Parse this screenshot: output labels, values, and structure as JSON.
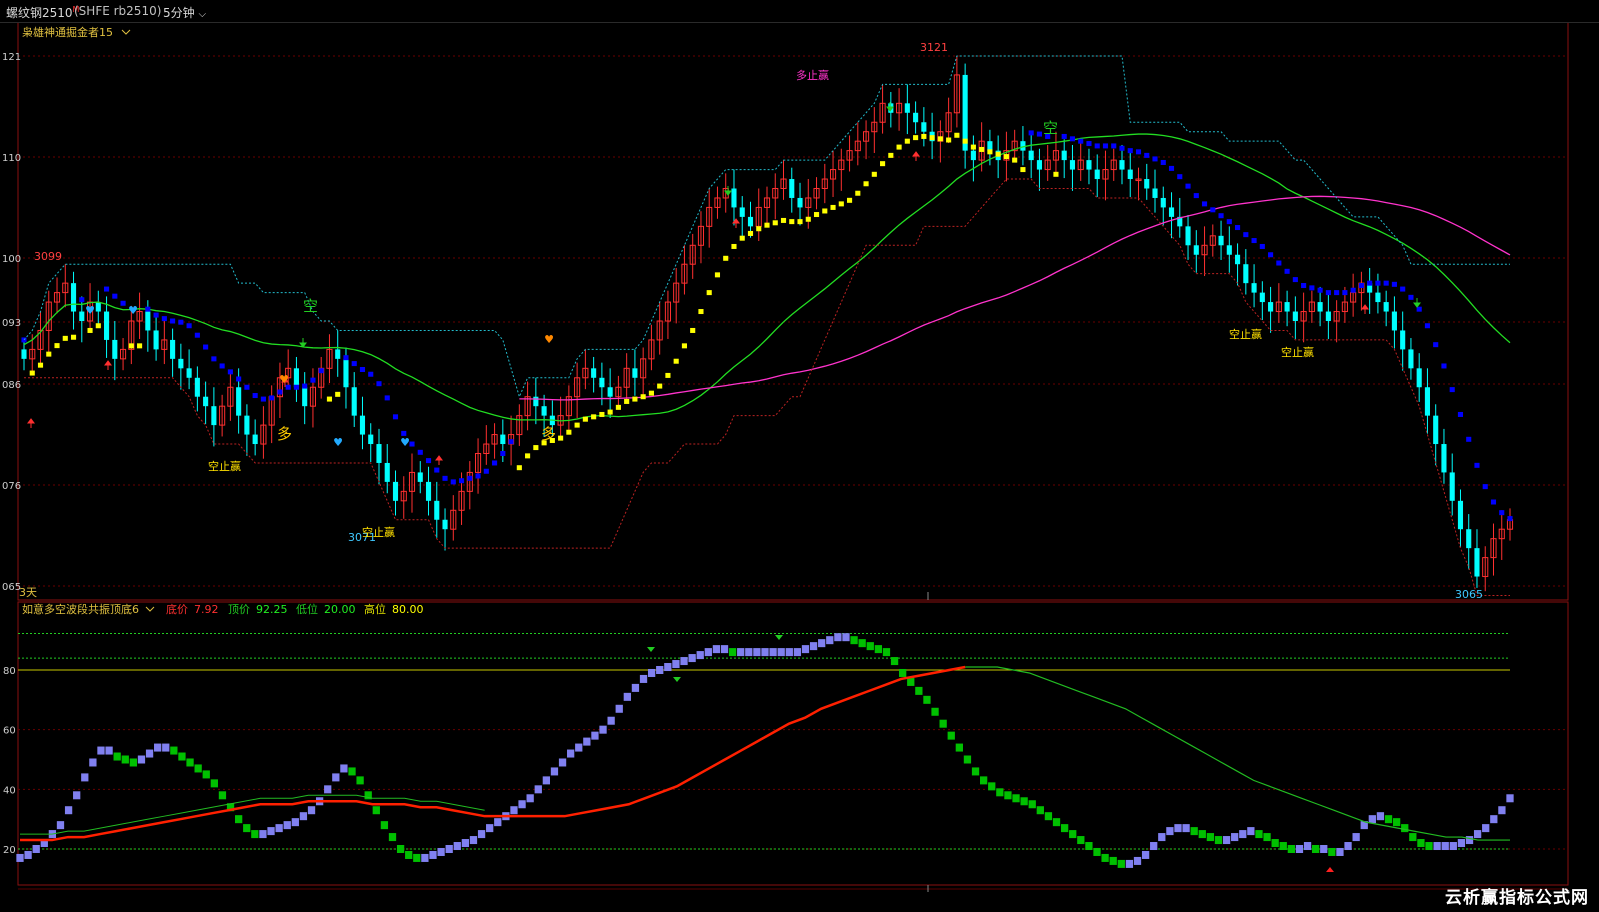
{
  "header": {
    "symbol": "螺纹钢2510",
    "symbol_mark": "M",
    "code": "(SHFE rb2510)",
    "period": "5分钟",
    "period_icon": "chevron-down-icon"
  },
  "main_panel": {
    "indicator_name": "枭雄神通掘金者15",
    "duration_label": "3天",
    "y_ticks": [
      "121",
      "110",
      "100",
      "093",
      "086",
      "076",
      "065"
    ],
    "annotations": [
      {
        "text": "3099",
        "color": "#ff4040"
      },
      {
        "text": "3121",
        "color": "#ff4040"
      },
      {
        "text": "3071",
        "color": "#3fc8ff"
      },
      {
        "text": "3065",
        "color": "#3fc8ff"
      },
      {
        "text": "多止赢",
        "color": "#ff33cc"
      },
      {
        "text": "空止赢",
        "color": "#ffe000"
      },
      {
        "text": "空止赢",
        "color": "#ffe000"
      },
      {
        "text": "空止赢",
        "color": "#ffe000"
      },
      {
        "text": "空止赢",
        "color": "#ffe000"
      },
      {
        "text": "空",
        "color": "#22cc22"
      },
      {
        "text": "空",
        "color": "#22cc22"
      },
      {
        "text": "多",
        "color": "#ffcc00"
      },
      {
        "text": "多",
        "color": "#ffcc00"
      }
    ]
  },
  "sub_panel": {
    "indicator_name": "如意多空波段共振顶底6",
    "legend": [
      {
        "label": "底价",
        "value": "7.92",
        "label_color": "#ff3030",
        "value_color": "#ff3030"
      },
      {
        "label": "顶价",
        "value": "92.25",
        "label_color": "#22cc22",
        "value_color": "#22ee22"
      },
      {
        "label": "低位",
        "value": "20.00",
        "label_color": "#22cc22",
        "value_color": "#22ee22"
      },
      {
        "label": "高位",
        "value": "80.00",
        "label_color": "#e0e000",
        "value_color": "#ffff00"
      }
    ],
    "y_ticks": [
      "80",
      "60",
      "40",
      "20"
    ]
  },
  "watermark": "云析赢指标公式网",
  "colors": {
    "up_candle": "#ff3030",
    "down_candle": "#00ffff",
    "ma_green": "#22dd22",
    "ma_magenta": "#ff33cc",
    "trail_yellow": "#ffff00",
    "trail_blue": "#0000ff",
    "osc_lilac": "#8080f0",
    "osc_green": "#00c000",
    "osc_red": "#ff2000"
  },
  "chart_data": [
    {
      "type": "candlestick",
      "title": "枭雄神通掘金者15",
      "y_ticks": [
        "121",
        "110",
        "100",
        "093",
        "086",
        "076",
        "065"
      ],
      "y_range_last3digits": [
        65,
        121
      ],
      "marked_high": 3121,
      "marked_low": 3065,
      "marked_levels": [
        3099,
        3121,
        3071,
        3065
      ],
      "closes": [
        3089,
        3090,
        3092,
        3095,
        3096,
        3097,
        3094,
        3093,
        3095,
        3094,
        3091,
        3089,
        3090,
        3093,
        3094,
        3092,
        3090,
        3091,
        3089,
        3088,
        3087,
        3085,
        3084,
        3082,
        3084,
        3086,
        3083,
        3081,
        3080,
        3082,
        3085,
        3087,
        3088,
        3086,
        3084,
        3086,
        3088,
        3090,
        3089,
        3086,
        3083,
        3081,
        3080,
        3078,
        3076,
        3074,
        3075,
        3077,
        3076,
        3074,
        3072,
        3071,
        3073,
        3075,
        3077,
        3079,
        3080,
        3081,
        3080,
        3081,
        3083,
        3085,
        3084,
        3083,
        3082,
        3083,
        3085,
        3087,
        3088,
        3087,
        3086,
        3085,
        3086,
        3088,
        3087,
        3089,
        3091,
        3093,
        3095,
        3097,
        3099,
        3101,
        3103,
        3105,
        3106,
        3107,
        3105,
        3104,
        3103,
        3105,
        3106,
        3107,
        3108,
        3106,
        3105,
        3106,
        3107,
        3108,
        3109,
        3110,
        3111,
        3112,
        3113,
        3114,
        3116,
        3115,
        3116,
        3115,
        3114,
        3113,
        3112,
        3113,
        3115,
        3119,
        3111,
        3110,
        3112,
        3111,
        3110,
        3111,
        3112,
        3111,
        3110,
        3109,
        3110,
        3111,
        3110,
        3109,
        3110,
        3109,
        3108,
        3109,
        3110,
        3109,
        3108,
        3108,
        3107,
        3106,
        3105,
        3104,
        3103,
        3101,
        3100,
        3101,
        3102,
        3101,
        3100,
        3099,
        3097,
        3096,
        3095,
        3094,
        3095,
        3094,
        3093,
        3094,
        3095,
        3094,
        3093,
        3094,
        3095,
        3096,
        3097,
        3096,
        3095,
        3094,
        3092,
        3090,
        3088,
        3086,
        3083,
        3080,
        3077,
        3074,
        3071,
        3069,
        3066,
        3068,
        3070,
        3071,
        3072
      ]
    },
    {
      "type": "line",
      "title": "如意多空波段共振顶底6",
      "series": [
        {
          "name": "底价",
          "last_value": 7.92
        },
        {
          "name": "顶价",
          "last_value": 92.25
        },
        {
          "name": "低位",
          "last_value": 20.0
        },
        {
          "name": "高位",
          "last_value": 80.0
        }
      ],
      "y_ticks": [
        80,
        60,
        40,
        20
      ],
      "oscillator": [
        17,
        18,
        20,
        22,
        25,
        28,
        33,
        38,
        44,
        49,
        53,
        53,
        51,
        50,
        49,
        50,
        52,
        54,
        54,
        53,
        51,
        49,
        47,
        45,
        42,
        38,
        34,
        30,
        27,
        25,
        25,
        26,
        27,
        28,
        29,
        31,
        33,
        36,
        40,
        44,
        47,
        46,
        43,
        38,
        33,
        28,
        24,
        20,
        18,
        17,
        17,
        18,
        19,
        20,
        21,
        22,
        23,
        25,
        27,
        29,
        31,
        33,
        35,
        37,
        40,
        43,
        46,
        49,
        52,
        54,
        56,
        58,
        60,
        63,
        67,
        71,
        74,
        77,
        79,
        80,
        81,
        82,
        83,
        84,
        85,
        86,
        87,
        87,
        86,
        86,
        86,
        86,
        86,
        86,
        86,
        86,
        86,
        87,
        88,
        89,
        90,
        91,
        91,
        90,
        89,
        88,
        87,
        86,
        83,
        79,
        76,
        73,
        70,
        66,
        62,
        58,
        54,
        50,
        46,
        43,
        41,
        39,
        38,
        37,
        36,
        35,
        33,
        31,
        29,
        27,
        25,
        23,
        21,
        19,
        17,
        16,
        15,
        15,
        16,
        18,
        21,
        24,
        26,
        27,
        27,
        26,
        25,
        24,
        23,
        23,
        24,
        25,
        26,
        25,
        24,
        22,
        21,
        20,
        20,
        21,
        20,
        20,
        19,
        19,
        21,
        24,
        28,
        30,
        31,
        30,
        29,
        27,
        24,
        22,
        21,
        21,
        21,
        21,
        22,
        23,
        25,
        27,
        30,
        33,
        37
      ],
      "slow_ma": [
        23,
        23,
        23,
        24,
        24,
        25,
        26,
        27,
        28,
        29,
        30,
        31,
        32,
        33,
        34,
        35,
        35,
        35,
        36,
        36,
        36,
        36,
        35,
        35,
        35,
        34,
        34,
        33,
        32,
        31,
        31,
        31,
        31,
        31,
        31,
        32,
        33,
        34,
        35,
        37,
        39,
        41,
        44,
        47,
        50,
        53,
        56,
        59,
        62,
        64,
        67,
        69,
        71,
        73,
        75,
        77,
        78,
        79,
        80,
        81,
        81,
        81,
        80,
        79,
        77,
        75,
        73,
        71,
        69,
        67,
        64,
        61,
        58,
        55,
        52,
        49,
        46,
        43,
        41,
        39,
        37,
        35,
        33,
        31,
        29,
        28,
        27,
        26,
        25,
        24,
        24,
        23,
        23,
        23
      ]
    }
  ]
}
